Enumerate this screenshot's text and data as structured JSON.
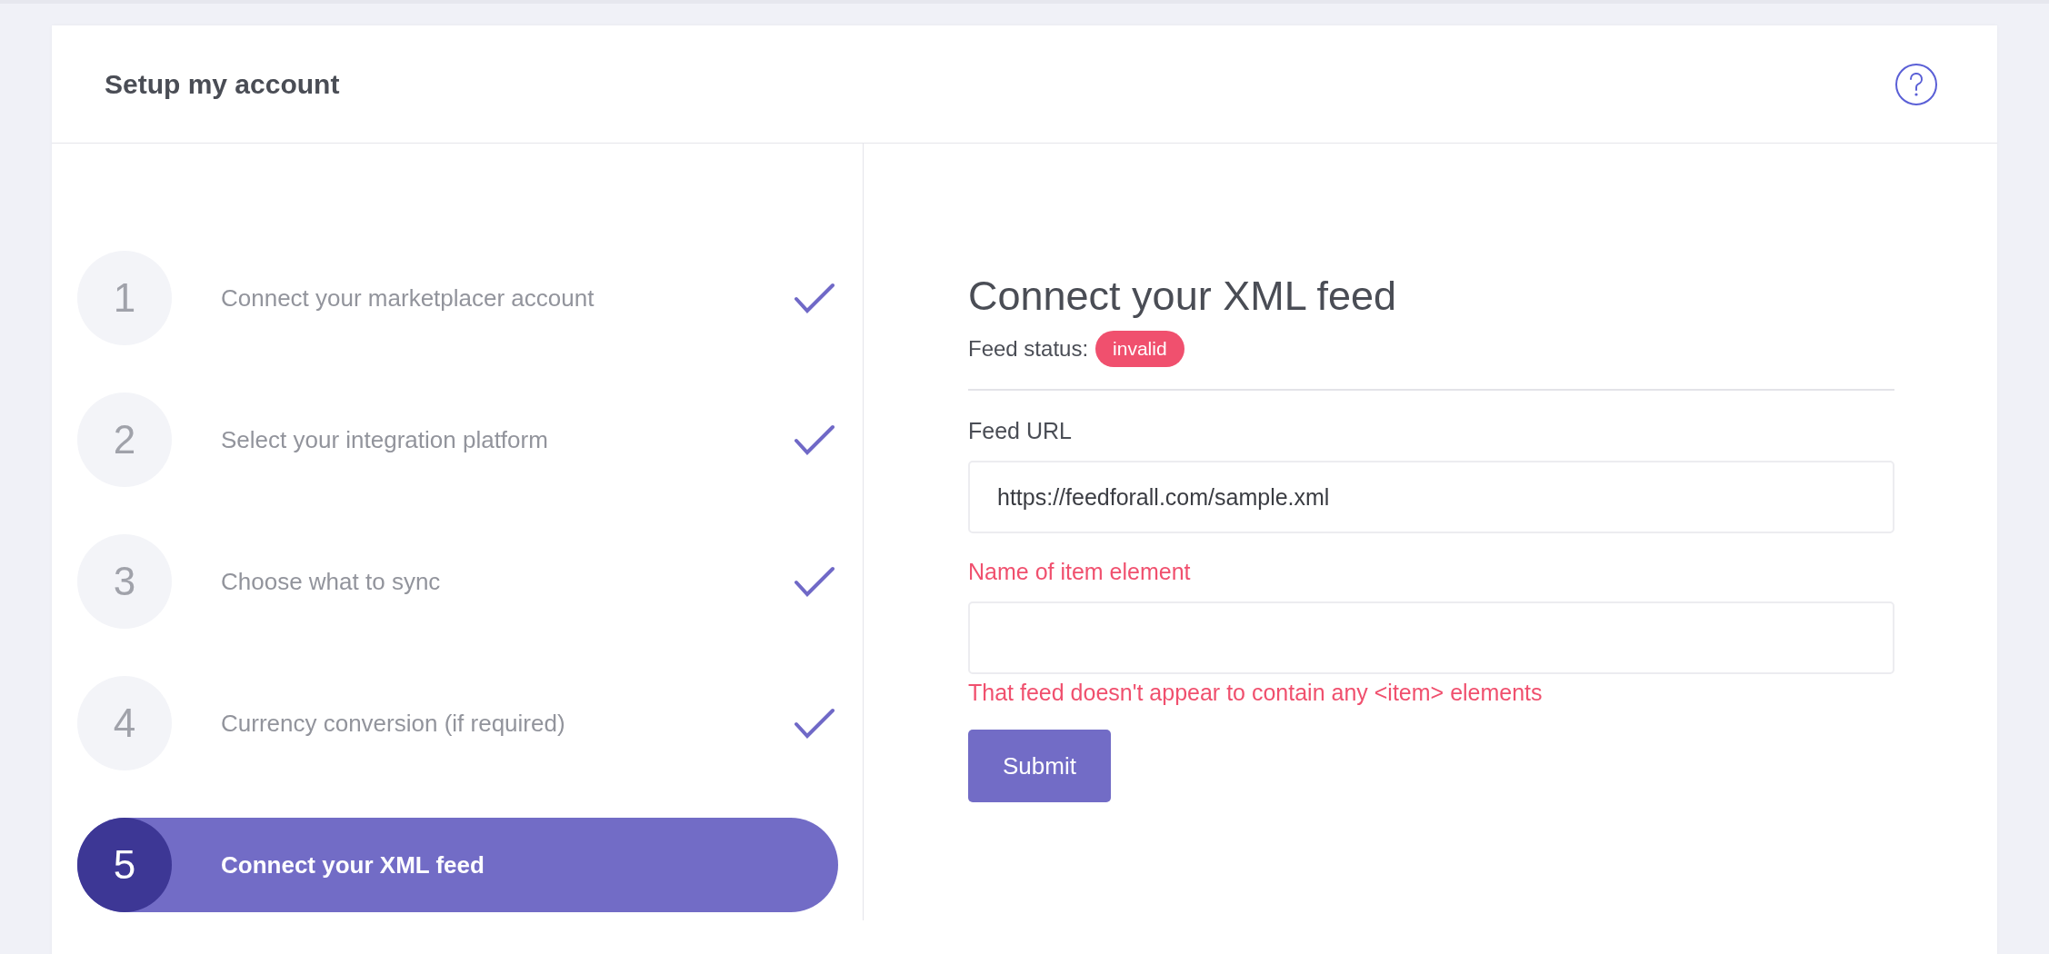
{
  "header": {
    "title": "Setup my account"
  },
  "steps": [
    {
      "number": "1",
      "label": "Connect your marketplacer account",
      "completed": true,
      "selected": false
    },
    {
      "number": "2",
      "label": "Select your integration platform",
      "completed": true,
      "selected": false
    },
    {
      "number": "3",
      "label": "Choose what to sync",
      "completed": true,
      "selected": false
    },
    {
      "number": "4",
      "label": "Currency conversion (if required)",
      "completed": true,
      "selected": false
    },
    {
      "number": "5",
      "label": "Connect your XML feed",
      "completed": false,
      "selected": true
    }
  ],
  "form": {
    "heading": "Connect your XML feed",
    "status_label": "Feed status:",
    "status": {
      "text": "invalid",
      "color": "#f0506e"
    },
    "fields": [
      {
        "label": "Feed URL",
        "value": "https://feedforall.com/sample.xml",
        "invalid": false
      },
      {
        "label": "Name of item element",
        "invalid": true,
        "error": "That feed doesn't appear to contain any <item> elements"
      }
    ],
    "submit": "Submit"
  }
}
